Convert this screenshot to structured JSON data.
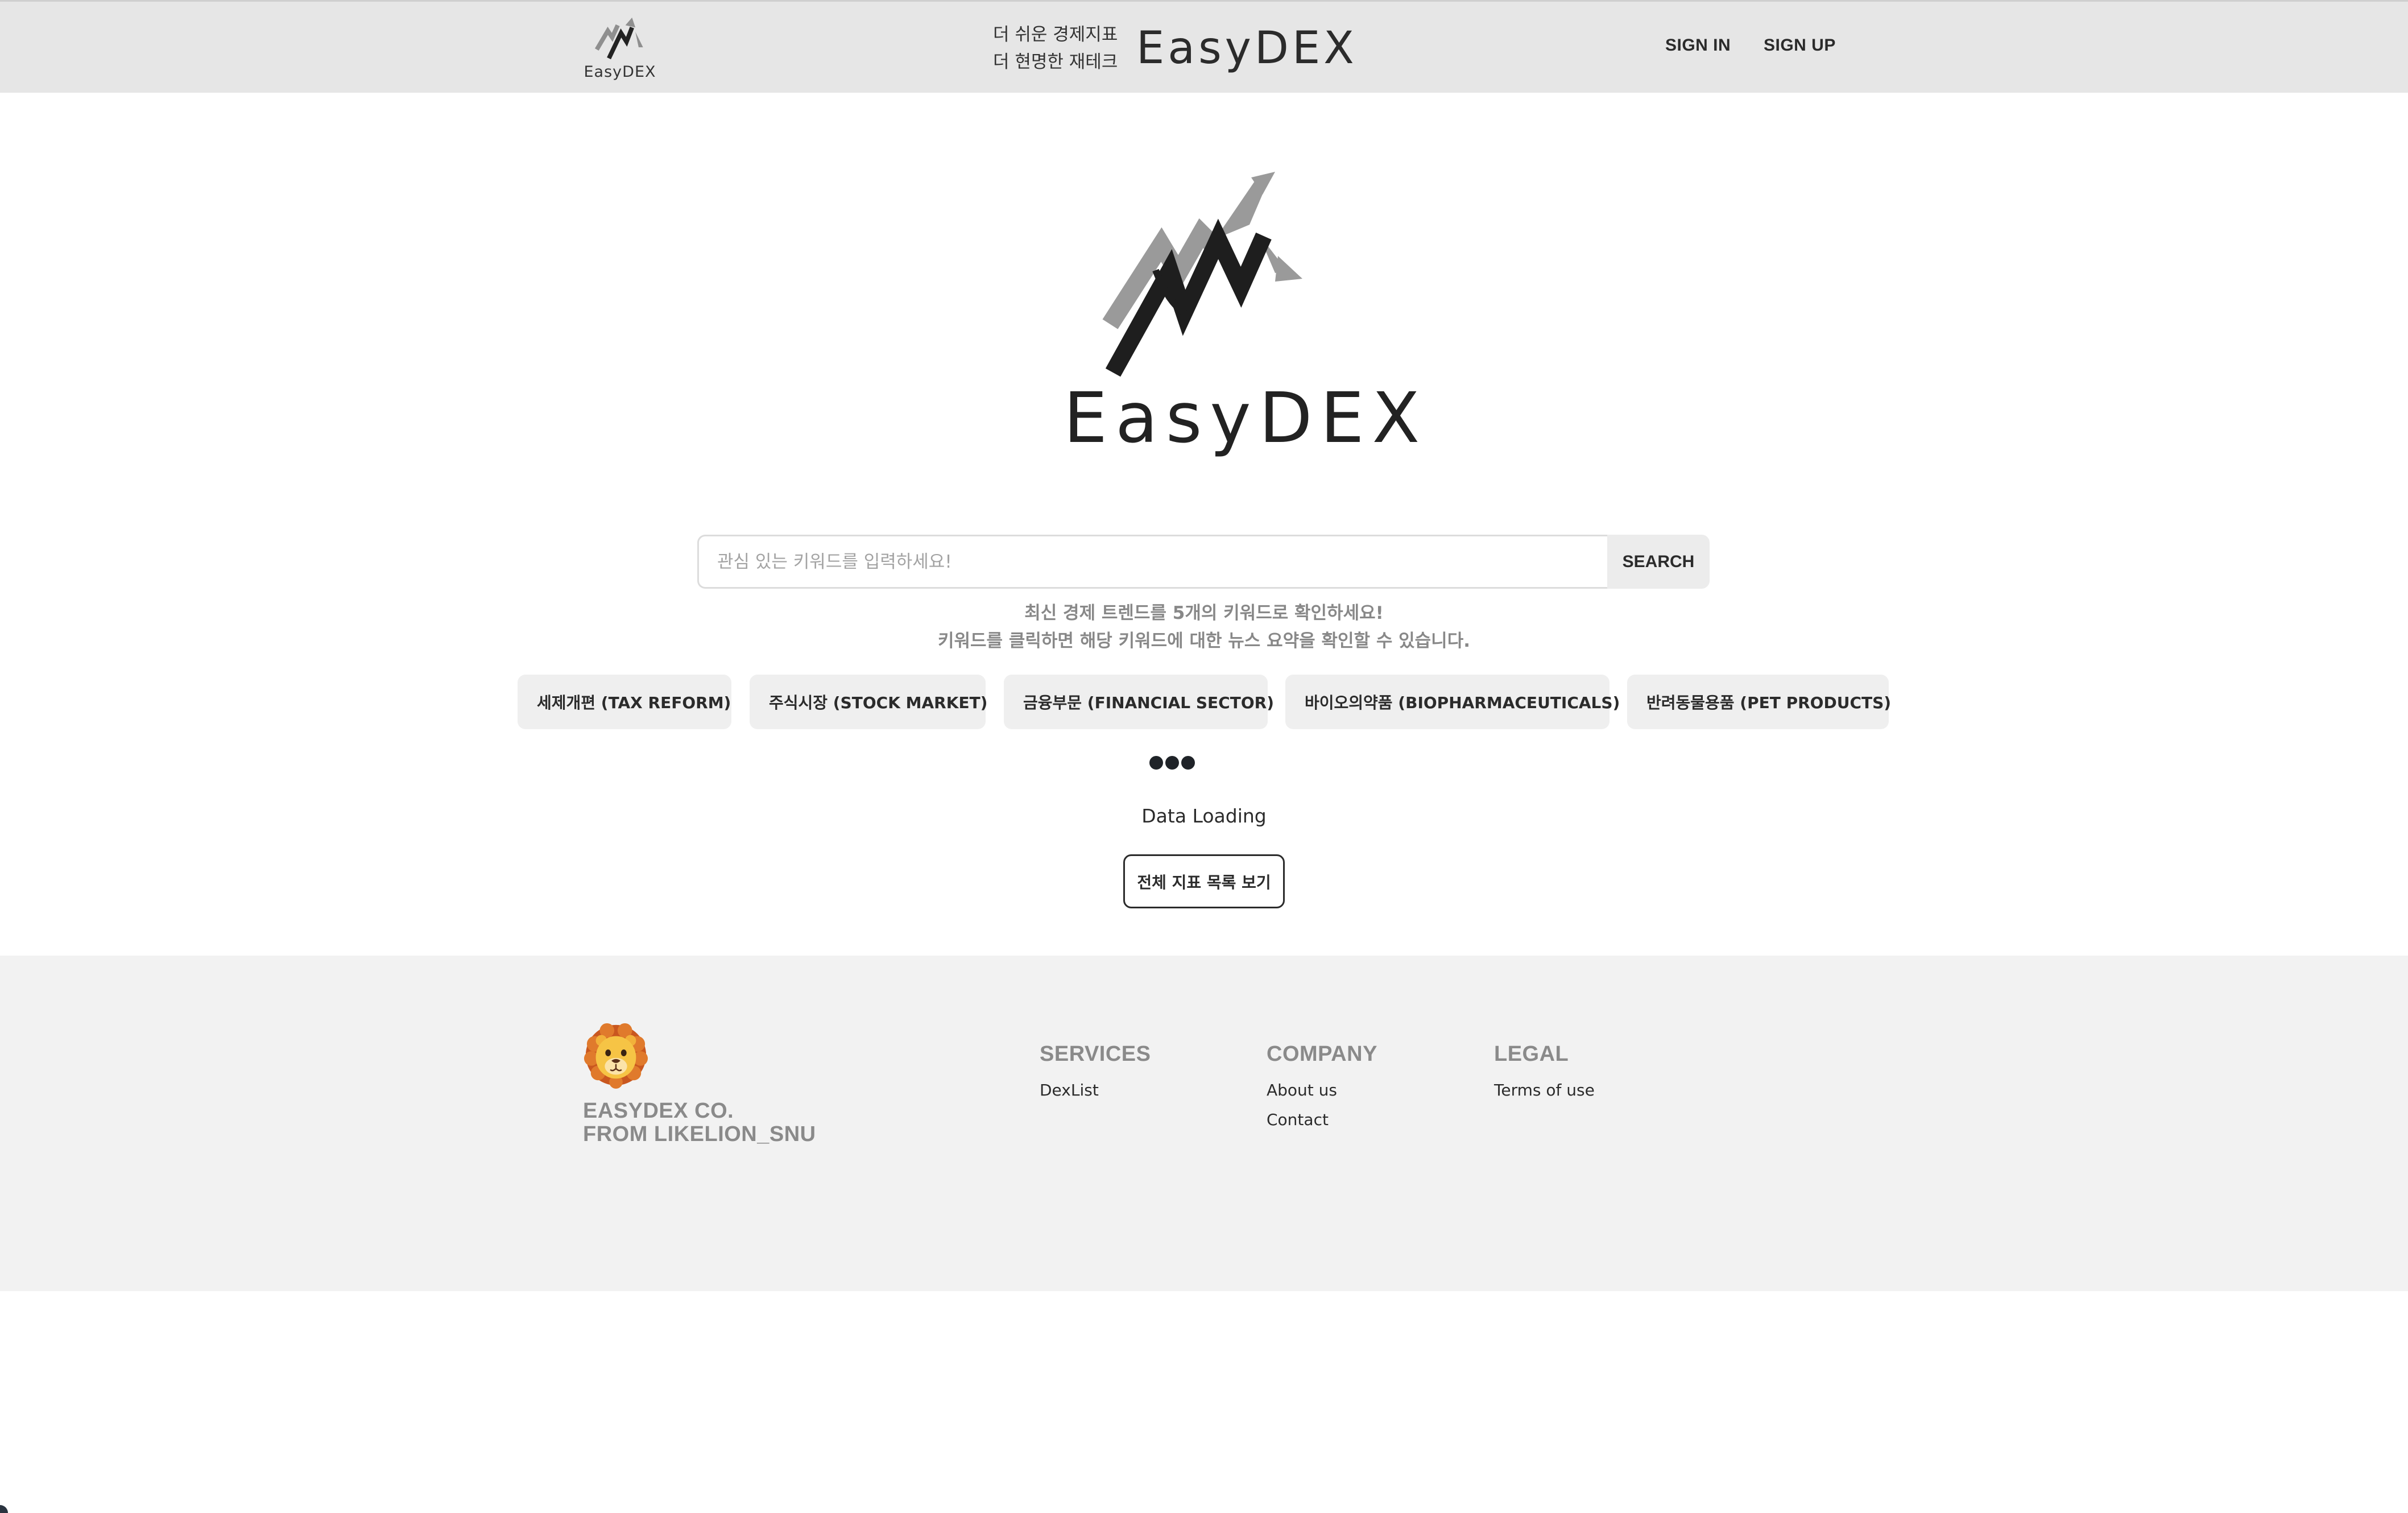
{
  "header": {
    "logo_text": "EasyDEX",
    "tagline_line1": "더 쉬운 경제지표",
    "tagline_line2": "더 현명한 재테크",
    "brand": "EasyDEX",
    "nav": {
      "sign_in": "SIGN IN",
      "sign_up": "SIGN UP"
    }
  },
  "hero": {
    "brand": "EasyDEX"
  },
  "search": {
    "placeholder": "관심 있는 키워드를 입력하세요!",
    "value": "",
    "button_label": "SEARCH"
  },
  "hints": {
    "line1": "최신 경제 트렌드를 5개의 키워드로 확인하세요!",
    "line2": "키워드를 클릭하면 해당 키워드에 대한 뉴스 요약을 확인할 수 있습니다."
  },
  "keywords": [
    "세제개편 (TAX REFORM)",
    "주식시장 (STOCK MARKET)",
    "금융부문 (FINANCIAL SECTOR)",
    "바이오의약품 (BIOPHARMACEUTICALS)",
    "반려동물용품 (PET PRODUCTS)"
  ],
  "loading": {
    "text": "Data Loading"
  },
  "all_list_button": "전체 지표 목록 보기",
  "footer": {
    "logo_icon": "lion-emoji",
    "company_line1": "EASYDEX CO.",
    "company_line2": "FROM LIKELION_SNU",
    "columns": {
      "services": {
        "title": "SERVICES",
        "links": [
          "DexList"
        ]
      },
      "company": {
        "title": "COMPANY",
        "links": [
          "About us",
          "Contact"
        ]
      },
      "legal": {
        "title": "LEGAL",
        "links": [
          "Terms of use"
        ]
      }
    }
  },
  "colors": {
    "header_bg": "#e6e6e6",
    "footer_bg": "#f2f2f2",
    "chip_bg": "#efefef",
    "text_dark": "#2b2b2b",
    "text_muted": "#8a8a8a"
  }
}
